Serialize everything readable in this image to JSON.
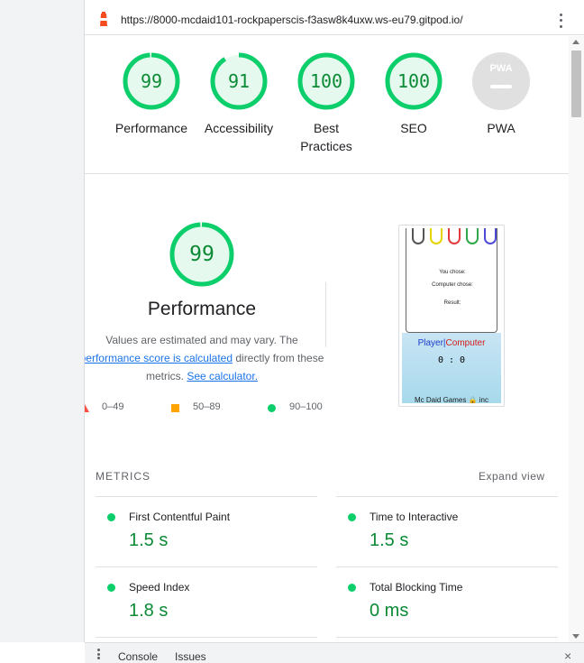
{
  "browser": {
    "url": "https://8000-mcdaid101-rockpaperscis-f3asw8k4uxw.ws-eu79.gitpod.io/"
  },
  "scores": [
    {
      "label": "Performance",
      "value": "99",
      "fraction": 0.99
    },
    {
      "label": "Accessibility",
      "value": "91",
      "fraction": 0.91
    },
    {
      "label": "Best Practices",
      "value": "100",
      "fraction": 1.0
    },
    {
      "label": "SEO",
      "value": "100",
      "fraction": 1.0
    }
  ],
  "pwa": {
    "label": "PWA",
    "badge_text": "PWA"
  },
  "performance": {
    "score": "99",
    "fraction": 0.99,
    "title": "Performance",
    "desc_pre": "Values are estimated and may vary. The ",
    "desc_link": "performance score is calculated",
    "desc_mid": " directly from these metrics. ",
    "desc_link2": "See calculator."
  },
  "legend": [
    {
      "range": "0–49",
      "shape": "triangle",
      "color": "#ff4e42"
    },
    {
      "range": "50–89",
      "shape": "square",
      "color": "#ffa400"
    },
    {
      "range": "90–100",
      "shape": "circle",
      "color": "#0cce6b"
    }
  ],
  "screenshot": {
    "you_chose": "You chose:",
    "computer_chose": "Computer chose:",
    "result": "Result:",
    "player": "Player",
    "sep": "|",
    "computer": "Computer",
    "score": "0 : 0",
    "footer": "Mc Daid Games 🔒 inc"
  },
  "metrics": {
    "header": "METRICS",
    "expand": "Expand view",
    "items": [
      {
        "name": "First Contentful Paint",
        "value": "1.5 s"
      },
      {
        "name": "Time to Interactive",
        "value": "1.5 s"
      },
      {
        "name": "Speed Index",
        "value": "1.8 s"
      },
      {
        "name": "Total Blocking Time",
        "value": "0 ms"
      }
    ]
  },
  "drawer": {
    "tabs": [
      "Console",
      "Issues"
    ],
    "close": "×"
  },
  "colors": {
    "pass": "#0cce6b",
    "pass_text": "#0b8a35",
    "pass_bg": "#e6f9ee",
    "link": "#1a73e8"
  }
}
